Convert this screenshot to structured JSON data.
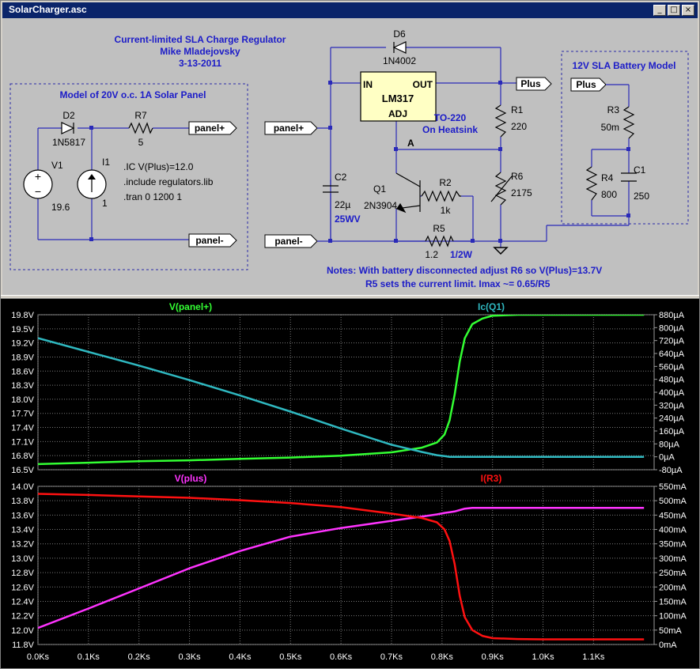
{
  "window": {
    "title": "SolarCharger.asc",
    "minimize_glyph": "_",
    "maximize_glyph": "□",
    "close_glyph": "×"
  },
  "schematic": {
    "title_lines": [
      "Current-limited SLA Charge Regulator",
      "Mike Mladejovsky",
      "3-13-2011"
    ],
    "solar_box_title": "Model of 20V o.c. 1A Solar Panel",
    "battery_box_title": "12V SLA Battery Model",
    "directives": [
      ".IC V(Plus)=12.0",
      ".include regulators.lib",
      ".tran 0 1200 1"
    ],
    "regulator": {
      "name": "LM317",
      "in": "IN",
      "out": "OUT",
      "adj": "ADJ"
    },
    "package_note": [
      "TO-220",
      "On Heatsink"
    ],
    "node_a": "A",
    "labels": {
      "panel_plus_1": "panel+",
      "panel_minus_1": "panel-",
      "panel_plus_2": "panel+",
      "panel_minus_2": "panel-",
      "plus_1": "Plus",
      "plus_2": "Plus"
    },
    "components": {
      "d2": {
        "name": "D2",
        "value": "1N5817"
      },
      "r7": {
        "name": "R7",
        "value": "5"
      },
      "v1": {
        "name": "V1",
        "value": "19.6"
      },
      "i1": {
        "name": "I1",
        "value": "1"
      },
      "d6": {
        "name": "D6",
        "value": "1N4002"
      },
      "c2": {
        "name": "C2",
        "value": "22µ",
        "rating": "25WV"
      },
      "q1": {
        "name": "Q1",
        "value": "2N3904"
      },
      "r1": {
        "name": "R1",
        "value": "220"
      },
      "r6": {
        "name": "R6",
        "value": "2175"
      },
      "r2": {
        "name": "R2",
        "value": "1k"
      },
      "r5": {
        "name": "R5",
        "value": "1.2",
        "rating": "1/2W"
      },
      "r3": {
        "name": "R3",
        "value": "50m"
      },
      "r4": {
        "name": "R4",
        "value": "800"
      },
      "c1": {
        "name": "C1",
        "value": "250"
      }
    },
    "notes": [
      "Notes:  With battery disconnected adjust R6 so V(Plus)=13.7V",
      "R5 sets the current limit.  Imax ~= 0.65/R5"
    ],
    "colors": {
      "text_blue": "#1c1cc8",
      "wire_blue": "#2a2ab8",
      "component": "#000000",
      "box_dash": "#2a2aa8"
    }
  },
  "chart_data": [
    {
      "type": "line",
      "x": [
        0,
        100,
        200,
        300,
        400,
        500,
        600,
        700,
        760,
        790,
        805,
        815,
        825,
        835,
        845,
        860,
        880,
        900,
        950,
        1000,
        1100,
        1200
      ],
      "series": [
        {
          "name": "V(panel+)",
          "axis": "left",
          "color": "#33ff33",
          "values": [
            16.62,
            16.65,
            16.68,
            16.7,
            16.73,
            16.76,
            16.8,
            16.87,
            16.97,
            17.08,
            17.25,
            17.55,
            18.1,
            18.8,
            19.3,
            19.6,
            19.72,
            19.78,
            19.8,
            19.8,
            19.8,
            19.8
          ]
        },
        {
          "name": "Ic(Q1)",
          "axis": "right",
          "color": "#2fb8c0",
          "values": [
            735,
            650,
            565,
            475,
            380,
            280,
            175,
            75,
            30,
            10,
            4,
            0,
            0,
            0,
            0,
            0,
            0,
            0,
            0,
            0,
            0,
            0
          ]
        }
      ],
      "xlim": [
        0,
        1220
      ],
      "ylim_left": [
        16.5,
        19.8
      ],
      "ylim_right": [
        -80,
        880
      ],
      "left_ticks": [
        "19.8V",
        "19.5V",
        "19.2V",
        "18.9V",
        "18.6V",
        "18.3V",
        "18.0V",
        "17.7V",
        "17.4V",
        "17.1V",
        "16.8V",
        "16.5V"
      ],
      "right_ticks": [
        "880µA",
        "800µA",
        "720µA",
        "640µA",
        "560µA",
        "480µA",
        "400µA",
        "320µA",
        "240µA",
        "160µA",
        "80µA",
        "0µA",
        "-80µA"
      ],
      "grid": true
    },
    {
      "type": "line",
      "x": [
        0,
        100,
        200,
        300,
        400,
        500,
        600,
        700,
        760,
        790,
        805,
        815,
        825,
        835,
        845,
        860,
        880,
        900,
        950,
        1000,
        1100,
        1200
      ],
      "series": [
        {
          "name": "V(plus)",
          "axis": "left",
          "color": "#ff33ff",
          "values": [
            12.03,
            12.3,
            12.58,
            12.86,
            13.1,
            13.3,
            13.42,
            13.52,
            13.58,
            13.61,
            13.63,
            13.64,
            13.65,
            13.67,
            13.69,
            13.7,
            13.7,
            13.7,
            13.7,
            13.7,
            13.7,
            13.7
          ]
        },
        {
          "name": "I(R3)",
          "axis": "right",
          "color": "#ff1111",
          "values": [
            524,
            520,
            515,
            510,
            502,
            492,
            478,
            455,
            440,
            425,
            400,
            360,
            280,
            170,
            95,
            50,
            30,
            22,
            19,
            18,
            18,
            18
          ]
        }
      ],
      "xlim": [
        0,
        1220
      ],
      "ylim_left": [
        11.8,
        14.0
      ],
      "ylim_right": [
        0,
        550
      ],
      "left_ticks": [
        "14.0V",
        "13.8V",
        "13.6V",
        "13.4V",
        "13.2V",
        "13.0V",
        "12.8V",
        "12.6V",
        "12.4V",
        "12.2V",
        "12.0V",
        "11.8V"
      ],
      "right_ticks": [
        "550mA",
        "500mA",
        "450mA",
        "400mA",
        "350mA",
        "300mA",
        "250mA",
        "200mA",
        "150mA",
        "100mA",
        "50mA",
        "0mA"
      ],
      "grid": true
    }
  ],
  "x_tick_labels": [
    "0.0Ks",
    "0.1Ks",
    "0.2Ks",
    "0.3Ks",
    "0.4Ks",
    "0.5Ks",
    "0.6Ks",
    "0.7Ks",
    "0.8Ks",
    "0.9Ks",
    "1.0Ks",
    "1.1Ks"
  ]
}
